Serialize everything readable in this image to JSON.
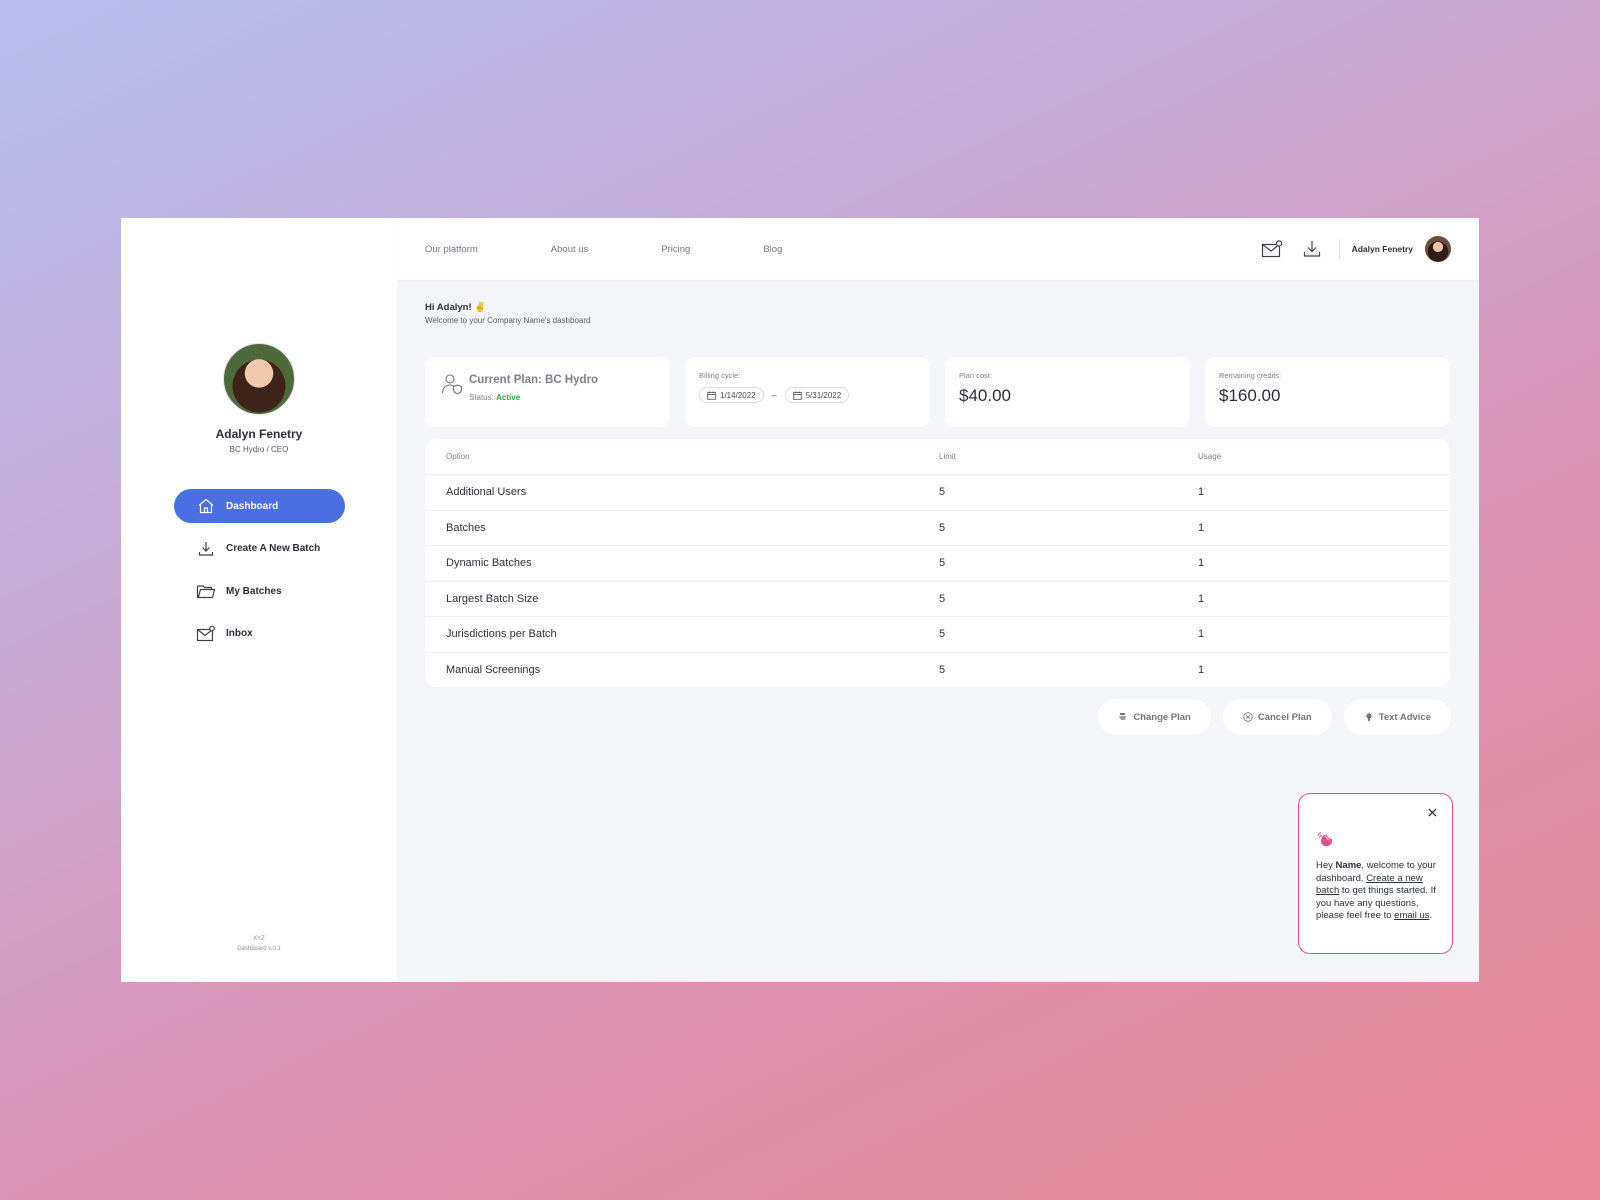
{
  "sidebar": {
    "user_name": "Adalyn Fenetry",
    "user_role": "BC Hydro / CEO",
    "nav": [
      {
        "label": "Dashboard",
        "icon": "home-icon",
        "active": true
      },
      {
        "label": "Create A New Batch",
        "icon": "download-icon",
        "active": false
      },
      {
        "label": "My Batches",
        "icon": "folder-icon",
        "active": false
      },
      {
        "label": "Inbox",
        "icon": "mail-icon",
        "active": false
      }
    ],
    "footer_line1": "XYZ",
    "footer_line2": "Dashboard v.0.1"
  },
  "topbar": {
    "links": [
      "Our platform",
      "About us",
      "Pricing",
      "Blog"
    ],
    "user_name": "Adalyn Fenetry"
  },
  "greeting": {
    "title": "Hi Adalyn! ✌",
    "subtitle": "Welcome to your Company Name's dashboard"
  },
  "cards": {
    "plan_title": "Current Plan: BC Hydro",
    "plan_status_label": "Status:",
    "plan_status_value": "Active",
    "billing_label": "Billing cycle:",
    "billing_start": "1/14/2022",
    "billing_end": "5/31/2022",
    "billing_sep": "–",
    "cost_label": "Plan cost:",
    "cost_value": "$40.00",
    "credits_label": "Remaining credits:",
    "credits_value": "$160.00"
  },
  "table": {
    "headers": [
      "Option",
      "Limit",
      "Usage"
    ],
    "rows": [
      [
        "Additional Users",
        "5",
        "1"
      ],
      [
        "Batches",
        "5",
        "1"
      ],
      [
        "Dynamic Batches",
        "5",
        "1"
      ],
      [
        "Largest Batch Size",
        "5",
        "1"
      ],
      [
        "Jurisdictions per Batch",
        "5",
        "1"
      ],
      [
        "Manual Screenings",
        "5",
        "1"
      ]
    ]
  },
  "actions": {
    "change_plan": "Change Plan",
    "cancel_plan": "Cancel Plan",
    "text_advice": "Text Advice"
  },
  "tip": {
    "t1": "Hey ",
    "name": "Name",
    "t2": ", welcome to your dashboard. ",
    "link1": "Create a new batch",
    "t3": " to get things started. If you have any questions, please feel free to ",
    "link2": "email us",
    "t4": "."
  },
  "colors": {
    "accent": "#4a6fe3",
    "active_status": "#2ea24a",
    "tip_border": "#e0508d"
  }
}
